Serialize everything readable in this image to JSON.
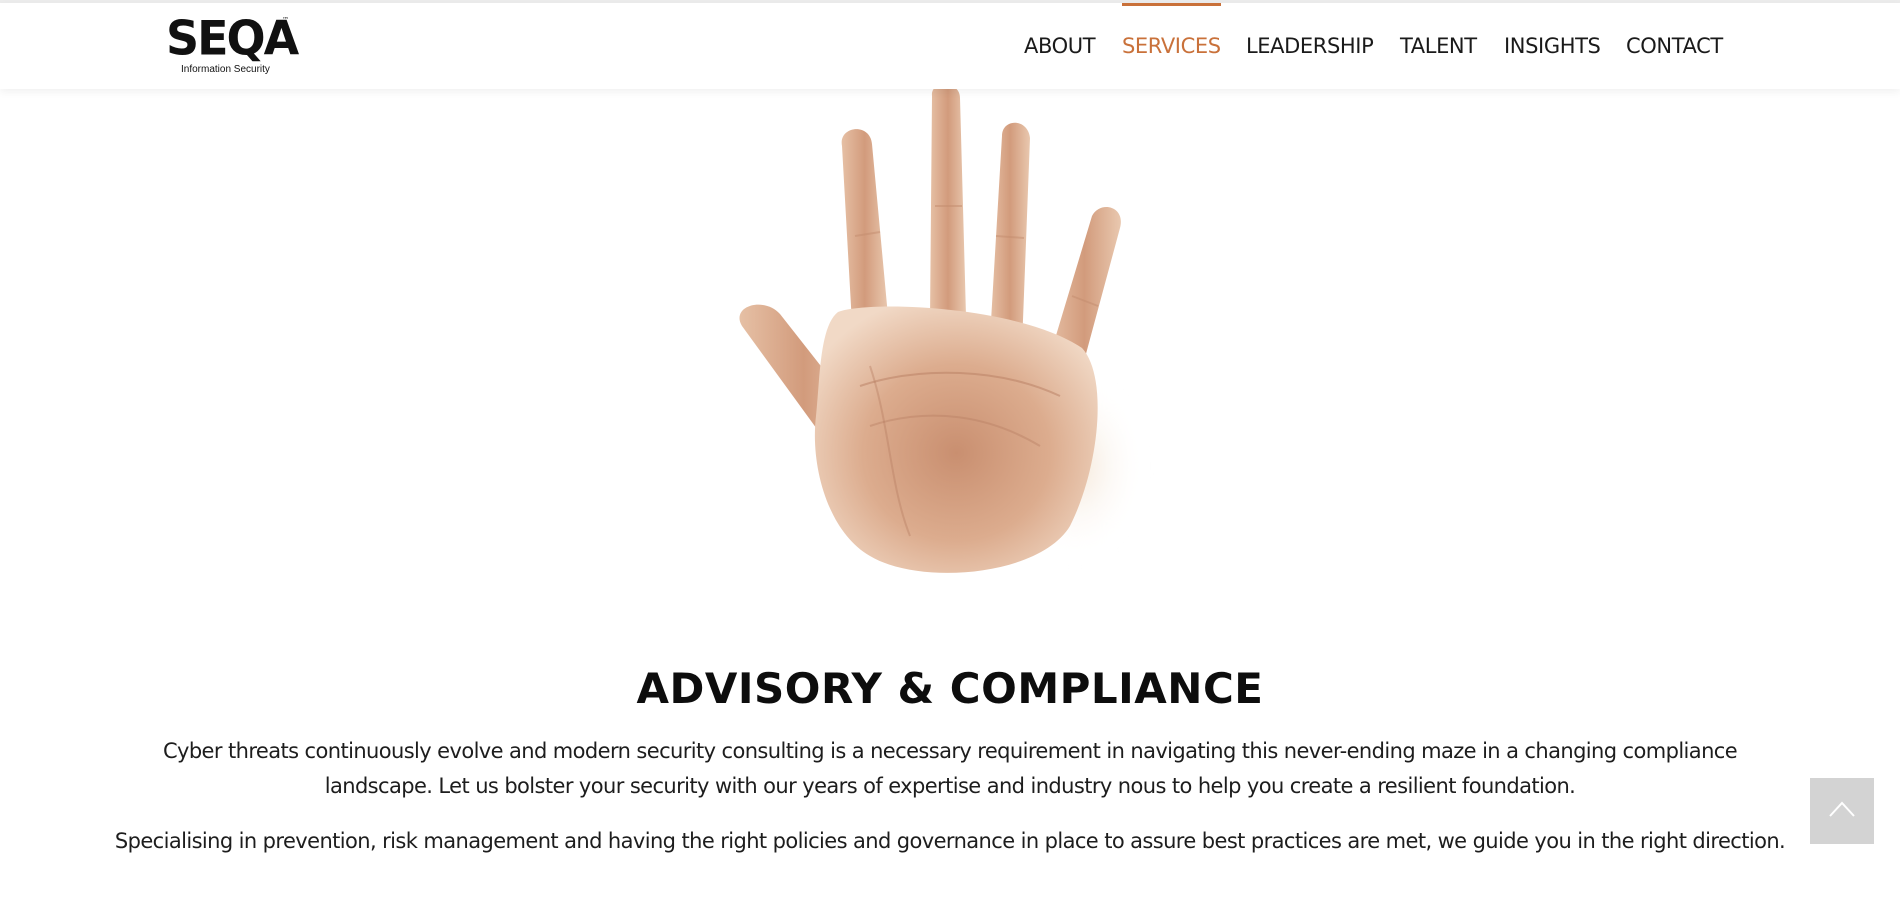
{
  "brand": {
    "name": "SEQA",
    "trademark": "™",
    "tagline": "Information Security"
  },
  "nav": {
    "items": [
      {
        "label": "ABOUT",
        "active": false
      },
      {
        "label": "SERVICES",
        "active": true
      },
      {
        "label": "LEADERSHIP",
        "active": false
      },
      {
        "label": "TALENT",
        "active": false
      },
      {
        "label": "INSIGHTS",
        "active": false
      },
      {
        "label": "CONTACT",
        "active": false
      }
    ]
  },
  "main": {
    "title": "ADVISORY & COMPLIANCE",
    "intro_line_1": "Cyber threats continuously evolve and modern security consulting is a necessary requirement in navigating this never-ending maze in a changing compliance",
    "intro_line_2": "landscape. Let us bolster your security with our years of expertise and industry nous to help you create a resilient foundation.",
    "paragraph_2": "Specialising in prevention, risk management and having the right policies and governance in place to assure best practices are met, we guide you in the right direction."
  },
  "icons": {
    "hero_image": "open-hand-palm",
    "scroll_top": "chevron-up-icon"
  },
  "colors": {
    "accent": "#c9713a",
    "text": "#1d1d1d",
    "scroll_button": "#d3d3d3"
  }
}
